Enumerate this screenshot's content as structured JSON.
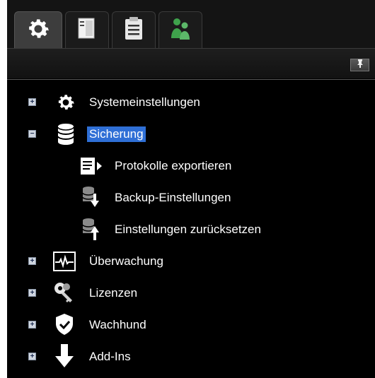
{
  "colors": {
    "background": "#000000",
    "selection": "#2f6fd6",
    "text": "#ffffff",
    "green_users": "#3fa24c"
  },
  "tabs": [
    {
      "icon": "gear-icon",
      "active": true
    },
    {
      "icon": "server-icon",
      "active": false
    },
    {
      "icon": "clipboard-icon",
      "active": false
    },
    {
      "icon": "users-icon",
      "active": false
    }
  ],
  "toolbar": {
    "pin_icon": "pin-icon"
  },
  "tree": {
    "items": [
      {
        "label": "Systemeinstellungen",
        "icon": "gear-icon",
        "expander": "+"
      },
      {
        "label": "Sicherung",
        "icon": "database-icon",
        "expander": "−",
        "selected": true
      },
      {
        "label": "Protokolle exportieren",
        "icon": "export-log-icon"
      },
      {
        "label": "Backup-Einstellungen",
        "icon": "backup-download-icon"
      },
      {
        "label": "Einstellungen zurücksetzen",
        "icon": "restore-upload-icon"
      },
      {
        "label": "Überwachung",
        "icon": "monitor-pulse-icon",
        "expander": "+"
      },
      {
        "label": "Lizenzen",
        "icon": "keys-icon",
        "expander": "+"
      },
      {
        "label": "Wachhund",
        "icon": "shield-check-icon",
        "expander": "+"
      },
      {
        "label": "Add-Ins",
        "icon": "download-arrow-icon",
        "expander": "+"
      }
    ]
  }
}
